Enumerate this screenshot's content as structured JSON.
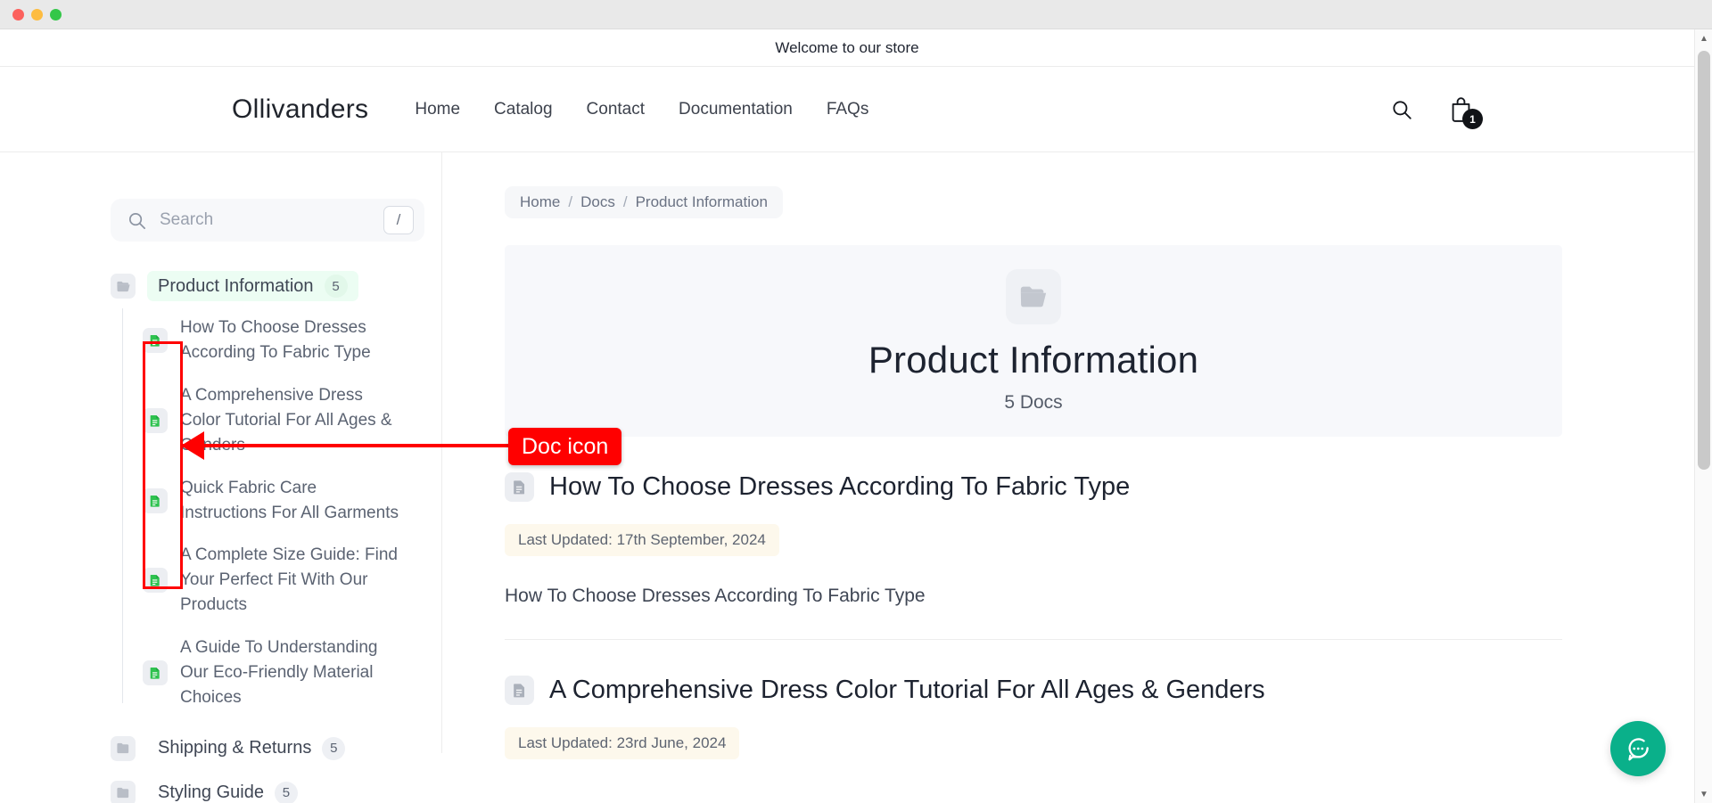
{
  "window": {
    "traffic_lights": [
      "close",
      "minimize",
      "zoom"
    ]
  },
  "announcement": {
    "text": "Welcome to our store"
  },
  "header": {
    "brand": "Ollivanders",
    "nav": [
      {
        "label": "Home",
        "name": "nav-home"
      },
      {
        "label": "Catalog",
        "name": "nav-catalog"
      },
      {
        "label": "Contact",
        "name": "nav-contact"
      },
      {
        "label": "Documentation",
        "name": "nav-documentation"
      },
      {
        "label": "FAQs",
        "name": "nav-faqs"
      }
    ],
    "search_icon": "search-icon",
    "cart_icon": "shopping-bag-icon",
    "cart_count": "1"
  },
  "sidebar": {
    "search": {
      "placeholder": "Search",
      "icon": "search-icon",
      "shortcut_key": "/"
    },
    "folders": [
      {
        "label": "Product Information",
        "count": "5",
        "active": true,
        "icon": "folder-open-icon",
        "docs": [
          {
            "title": "How To Choose Dresses According To Fabric Type",
            "icon": "doc-icon"
          },
          {
            "title": "A Comprehensive Dress Color Tutorial For All Ages & Genders",
            "icon": "doc-icon"
          },
          {
            "title": "Quick Fabric Care Instructions For All Garments",
            "icon": "doc-icon"
          },
          {
            "title": "A Complete Size Guide: Find Your Perfect Fit With Our Products",
            "icon": "doc-icon"
          },
          {
            "title": "A Guide To Understanding Our Eco-Friendly Material Choices",
            "icon": "doc-icon"
          }
        ]
      },
      {
        "label": "Shipping & Returns",
        "count": "5",
        "active": false,
        "icon": "folder-icon",
        "docs": []
      },
      {
        "label": "Styling Guide",
        "count": "5",
        "active": false,
        "icon": "folder-icon",
        "docs": []
      }
    ]
  },
  "breadcrumb": {
    "items": [
      "Home",
      "Docs",
      "Product Information"
    ],
    "separator": "/"
  },
  "hero": {
    "icon": "folder-open-icon",
    "title": "Product Information",
    "subtitle": "5 Docs"
  },
  "articles": [
    {
      "icon": "doc-icon",
      "title": "How To Choose Dresses According To Fabric Type",
      "updated": "Last Updated: 17th September, 2024",
      "excerpt": "How To Choose Dresses According To Fabric Type"
    },
    {
      "icon": "doc-icon",
      "title": "A Comprehensive Dress Color Tutorial For All Ages & Genders",
      "updated": "Last Updated: 23rd June, 2024",
      "excerpt": ""
    }
  ],
  "chat_widget": {
    "icon": "chat-bubble-icon"
  },
  "annotation": {
    "label": "Doc icon",
    "color": "#ff0000"
  },
  "scrollbar": {
    "up_arrow": "▲",
    "down_arrow": "▼"
  },
  "colors": {
    "accent_green": "#0ab08a",
    "doc_icon_green": "#2ec24f",
    "active_bg": "#ecfdf3",
    "updated_bg": "#fdf8ec",
    "annotation_red": "#ff0000"
  }
}
